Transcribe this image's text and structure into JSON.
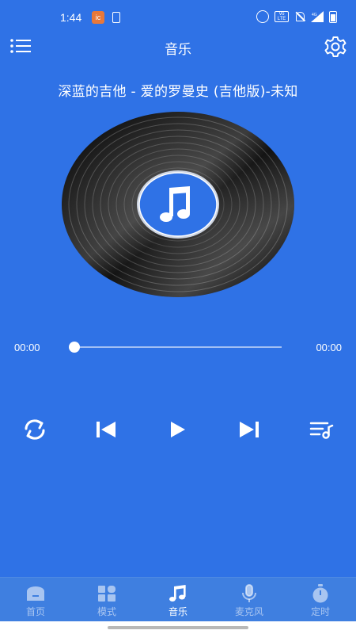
{
  "status_bar": {
    "time": "1:44",
    "app_badge": "ic",
    "volte_label": "Vo LTE",
    "network": "4G"
  },
  "header": {
    "title": "音乐",
    "menu_icon": "list-menu-icon",
    "settings_icon": "gear-icon"
  },
  "player": {
    "song_title": "深蓝的吉他 - 爱的罗曼史 (吉他版)-未知",
    "current_time": "00:00",
    "total_time": "00:00",
    "progress": 0,
    "disc_icon": "music-note-icon"
  },
  "controls": {
    "repeat_icon": "repeat-icon",
    "previous_icon": "previous-track-icon",
    "play_icon": "play-icon",
    "next_icon": "next-track-icon",
    "playlist_icon": "playlist-icon"
  },
  "bottom_nav": {
    "items": [
      {
        "label": "首页",
        "icon": "home-icon",
        "active": false
      },
      {
        "label": "模式",
        "icon": "grid-icon",
        "active": false
      },
      {
        "label": "音乐",
        "icon": "music-note-icon",
        "active": true
      },
      {
        "label": "麦克风",
        "icon": "microphone-icon",
        "active": false
      },
      {
        "label": "定时",
        "icon": "timer-icon",
        "active": false
      }
    ]
  },
  "colors": {
    "background": "#2f72e6",
    "nav_background": "#3f7fe0",
    "disc_label": "#2f72e6"
  }
}
